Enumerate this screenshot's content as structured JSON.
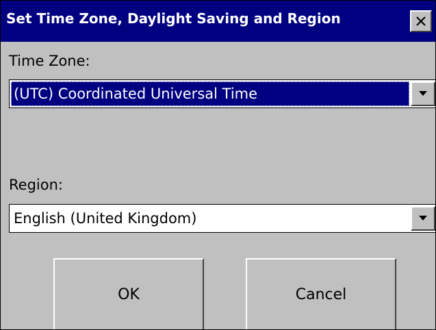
{
  "window": {
    "title": "Set Time Zone, Daylight Saving and Region",
    "close_glyph": "✕"
  },
  "time_zone": {
    "label": "Time Zone:",
    "value": "(UTC) Coordinated Universal Time"
  },
  "region": {
    "label": "Region:",
    "value": "English (United Kingdom)"
  },
  "buttons": {
    "ok": "OK",
    "cancel": "Cancel"
  },
  "colors": {
    "titlebar": "#000080",
    "face": "#c0c0c0",
    "selection": "#000080"
  }
}
